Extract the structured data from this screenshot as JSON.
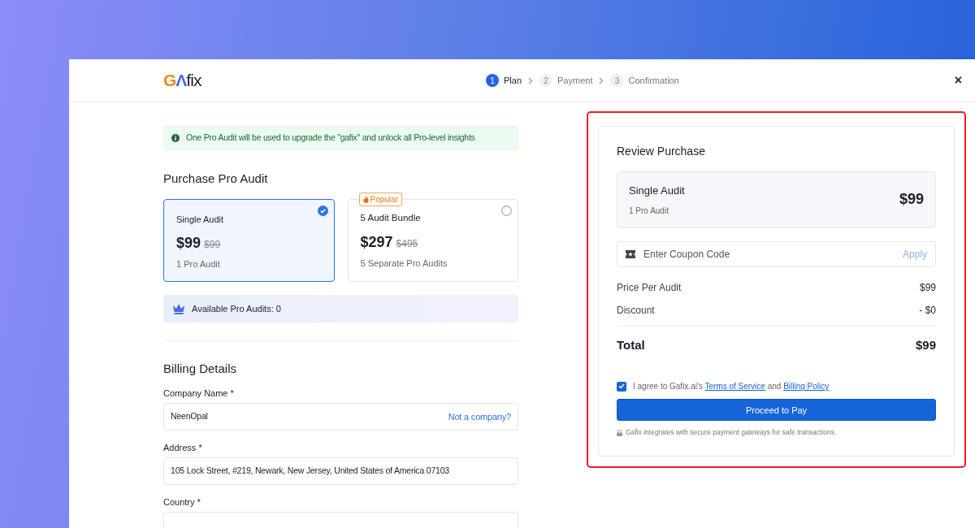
{
  "header": {
    "logo": "GΛfix",
    "steps": [
      {
        "number": "1",
        "label": "Plan",
        "selected": true
      },
      {
        "number": "2",
        "label": "Payment",
        "selected": false
      },
      {
        "number": "3",
        "label": "Confirmation",
        "selected": false
      }
    ],
    "close": "×"
  },
  "notice": "One Pro Audit will be used to upgrade the \"gafix\" and unlock all Pro-level insights",
  "plans": {
    "title": "Purchase Pro Audit",
    "items": [
      {
        "name": "Single Audit",
        "price": "$99",
        "old_price": "$99",
        "subtitle": "1 Pro Audit",
        "selected": true
      },
      {
        "badge": "Popular",
        "name": "5 Audit Bundle",
        "price": "$297",
        "old_price": "$495",
        "subtitle": "5 Separate Pro Audits",
        "selected": false
      }
    ]
  },
  "available": "Available Pro Audits: 0",
  "billing": {
    "title": "Billing Details",
    "fields": [
      {
        "label": "Company Name *",
        "value": "NeenOpal",
        "link": "Not a company?"
      },
      {
        "label": "Address *",
        "value": "105 Lock Street, #219, Newark, New Jersey, United States of America 07103"
      },
      {
        "label": "Country *"
      }
    ]
  },
  "review": {
    "highlighted": true,
    "title": "Review Purchase",
    "item": {
      "name": "Single Audit",
      "subtitle": "1 Pro Audit",
      "price": "$99"
    },
    "coupon": {
      "placeholder": "Enter Coupon Code",
      "action": "Apply"
    },
    "lines": [
      {
        "label": "Price Per Audit",
        "value": "$99"
      },
      {
        "label": "Discount",
        "value": "- $0"
      }
    ],
    "total": {
      "label": "Total",
      "value": "$99"
    },
    "agree": {
      "checked": true,
      "text": "I agree to Gafix.ai's",
      "link_1": "Terms of Service",
      "joiner": "and",
      "link_2": "Billing Policy"
    },
    "button": "Proceed to Pay",
    "note": "Gafix integrates with secure payment gateways for safe transactions."
  }
}
